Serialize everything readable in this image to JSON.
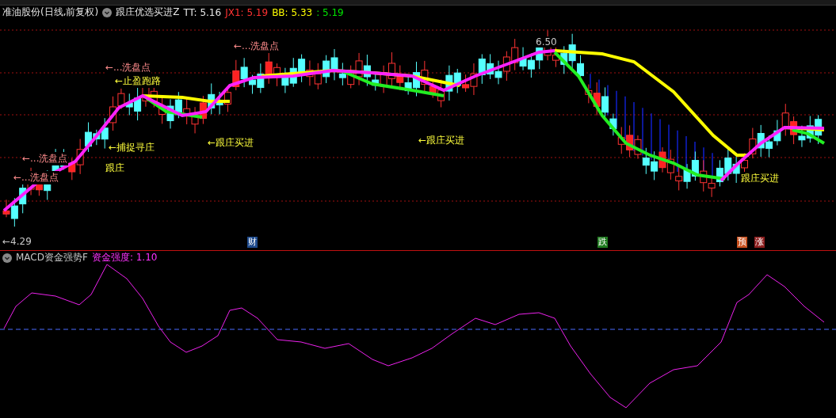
{
  "header": {
    "stock": "准油股份(日线,前复权)",
    "indicator": "跟庄优选买进Z",
    "values": [
      {
        "label": "TT: 5.16",
        "color": "#e6e6e6"
      },
      {
        "label": "JX1: 5.19",
        "color": "#ff3232"
      },
      {
        "label": "BB: 5.33",
        "color": "#ffff00"
      },
      {
        "label": ": 5.19",
        "color": "#00e600"
      }
    ]
  },
  "annotations": [
    {
      "text": "←...洗盘点",
      "kind": "wash"
    },
    {
      "text": "←...洗盘点",
      "kind": "wash"
    },
    {
      "text": "←止盈跑路",
      "kind": "signal"
    },
    {
      "text": "←捕捉寻庄",
      "kind": "signal"
    },
    {
      "text": "跟庄",
      "kind": "signal"
    },
    {
      "text": "←跟庄买进",
      "kind": "signal"
    },
    {
      "text": "←...洗盘点",
      "kind": "wash"
    },
    {
      "text": "←...洗盘点",
      "kind": "wash"
    },
    {
      "text": "←4.29",
      "kind": "price"
    },
    {
      "text": "←跟庄买进",
      "kind": "signal"
    },
    {
      "text": "6.50",
      "kind": "price"
    },
    {
      "text": "跟庄买进",
      "kind": "signal"
    }
  ],
  "markers": [
    {
      "text": "财",
      "color": "#1e4a8c"
    },
    {
      "text": "跌",
      "color": "#1f7a1f"
    },
    {
      "text": "预",
      "color": "#c8501e"
    },
    {
      "text": "涨",
      "color": "#8c1e1e"
    }
  ],
  "lower": {
    "indicator": "MACD资金强势F",
    "reading": "资金强度: 1.10"
  }
}
